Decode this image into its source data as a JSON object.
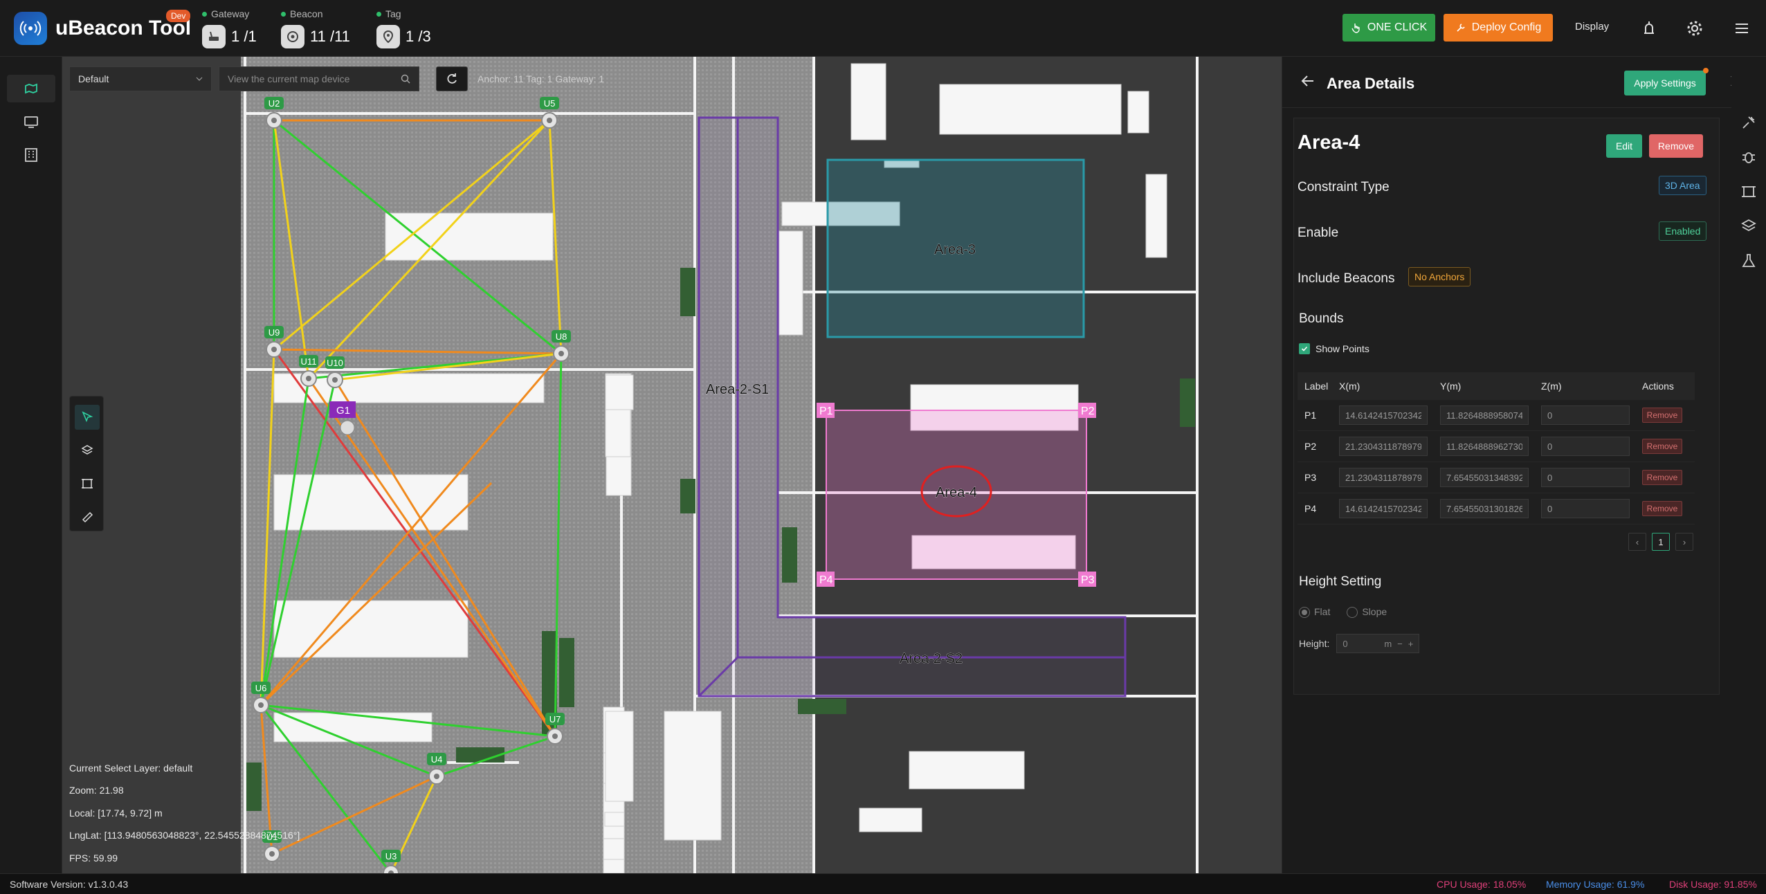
{
  "app": {
    "title": "uBeacon Tool",
    "badge": "Dev"
  },
  "stats": {
    "gateway": {
      "label": "Gateway",
      "value": "1 /1"
    },
    "beacon": {
      "label": "Beacon",
      "value": "11 /11"
    },
    "tag": {
      "label": "Tag",
      "value": "1 /3"
    }
  },
  "toolbar": {
    "one_click": "ONE CLICK",
    "deploy": "Deploy Config",
    "display": "Display"
  },
  "map": {
    "layer": "Default",
    "search_placeholder": "View the current map device",
    "counts": "Anchor: 11   Tag: 1   Gateway: 1",
    "info": {
      "layer": "Current Select Layer:  default",
      "zoom": "Zoom:  21.98",
      "local": "Local:  [17.74,  9.72] m",
      "lnglat": "LngLat:  [113.9480563048823°, 22.54552884874516°]",
      "fps": "FPS:  59.99"
    },
    "labels": {
      "area3": "Area-3",
      "area4": "Area-4",
      "area2s1": "Area-2-S1",
      "area2s2": "Area-2-S2",
      "g1": "G1",
      "p1": "P1",
      "p2": "P2",
      "p3": "P3",
      "p4": "P4"
    },
    "anchors": [
      {
        "id": "U2"
      },
      {
        "id": "U5"
      },
      {
        "id": "U9"
      },
      {
        "id": "U8"
      },
      {
        "id": "U11"
      },
      {
        "id": "U10"
      },
      {
        "id": "U6"
      },
      {
        "id": "U7"
      },
      {
        "id": "U4"
      },
      {
        "id": "U3"
      },
      {
        "id": "U1"
      }
    ],
    "colors": {
      "green": "#2fd02f",
      "yellow": "#f2d21a",
      "orange": "#f08a1e",
      "red": "#e03c3c",
      "area_purple": "#6a3aa8",
      "area_teal": "#2a8a9a",
      "area_pink": "#f07ad0"
    }
  },
  "panel": {
    "title": "Area Details",
    "apply": "Apply Settings",
    "area_name": "Area-4",
    "edit": "Edit",
    "remove": "Remove",
    "constraint_label": "Constraint Type",
    "constraint_value": "3D Area",
    "enable_label": "Enable",
    "enable_value": "Enabled",
    "include_label": "Include Beacons",
    "include_value": "No Anchors",
    "bounds_title": "Bounds",
    "show_points": "Show Points",
    "table": {
      "headers": [
        "Label",
        "X(m)",
        "Y(m)",
        "Z(m)",
        "Actions"
      ],
      "rows": [
        {
          "label": "P1",
          "x": "14.6142415702342",
          "y": "11.8264888958074",
          "z": "0",
          "action": "Remove"
        },
        {
          "label": "P2",
          "x": "21.2304311878979",
          "y": "11.8264888962730",
          "z": "0",
          "action": "Remove"
        },
        {
          "label": "P3",
          "x": "21.2304311878979",
          "y": "7.65455031348392",
          "z": "0",
          "action": "Remove"
        },
        {
          "label": "P4",
          "x": "14.6142415702342",
          "y": "7.65455031301826",
          "z": "0",
          "action": "Remove"
        }
      ]
    },
    "page": "1",
    "height_title": "Height Setting",
    "flat": "Flat",
    "slope": "Slope",
    "height_label": "Height:",
    "height_value": "0",
    "height_unit": "m"
  },
  "status": {
    "version": "Software Version:  v1.3.0.43",
    "cpu": "CPU Usage:  18.05%",
    "memory": "Memory Usage:  61.9%",
    "disk": "Disk Usage:  91.85%"
  }
}
